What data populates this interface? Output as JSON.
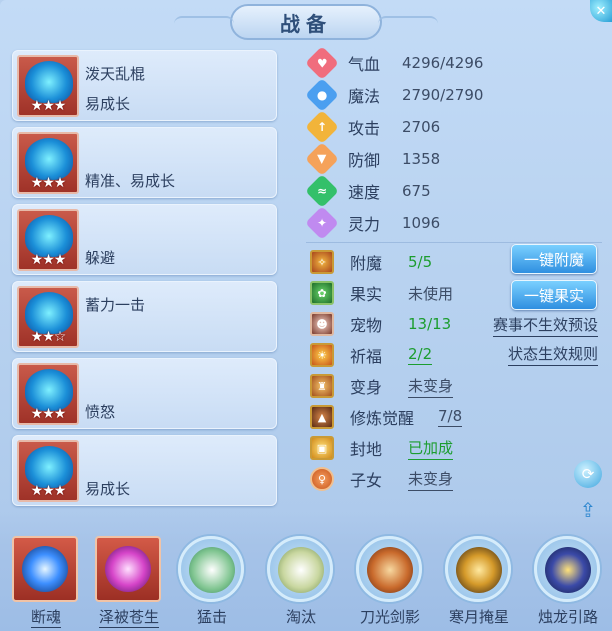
{
  "header": {
    "title": "战备"
  },
  "skills": [
    {
      "name1": "泼天乱棍",
      "name2": "易成长",
      "stars": "★★★",
      "color": "#1d97e0"
    },
    {
      "name1": "",
      "name2": "精准、易成长",
      "stars": "★★★",
      "color": "#1d97e0"
    },
    {
      "name1": "",
      "name2": "躲避",
      "stars": "★★★",
      "color": "#1d97e0"
    },
    {
      "name1": "蓄力一击",
      "name2": "",
      "stars": "★★☆",
      "color": "#1d97e0"
    },
    {
      "name1": "",
      "name2": "愤怒",
      "stars": "★★★",
      "color": "#1d97e0"
    },
    {
      "name1": "",
      "name2": "易成长",
      "stars": "★★★",
      "color": "#1d97e0"
    }
  ],
  "stats": [
    {
      "label": "气血",
      "value": "4296/4296",
      "icon": "heart-icon",
      "color": "#f06d7d",
      "glyph": "♥"
    },
    {
      "label": "魔法",
      "value": "2790/2790",
      "icon": "magic-icon",
      "color": "#4b9ff0",
      "glyph": "●"
    },
    {
      "label": "攻击",
      "value": "2706",
      "icon": "sword-icon",
      "color": "#f2b43a",
      "glyph": "↑"
    },
    {
      "label": "防御",
      "value": "1358",
      "icon": "shield-icon",
      "color": "#f5a25a",
      "glyph": "▼"
    },
    {
      "label": "速度",
      "value": "675",
      "icon": "speed-icon",
      "color": "#33c06a",
      "glyph": "≈"
    },
    {
      "label": "灵力",
      "value": "1096",
      "icon": "spirit-icon",
      "color": "#c08af0",
      "glyph": "✦"
    }
  ],
  "extras": [
    {
      "label": "附魔",
      "value": "5/5",
      "style": "green",
      "icon": "enchant-icon"
    },
    {
      "label": "果实",
      "value": "未使用",
      "style": "plain",
      "icon": "fruit-icon"
    },
    {
      "label": "宠物",
      "value": "13/13",
      "style": "green",
      "icon": "pet-icon"
    },
    {
      "label": "祈福",
      "value": "2/2",
      "style": "green-ul",
      "icon": "blessing-icon"
    },
    {
      "label": "变身",
      "value": "未变身",
      "style": "ul",
      "icon": "transform-icon"
    },
    {
      "label": "修炼觉醒",
      "value": "7/8",
      "style": "ul",
      "icon": "cultivation-icon"
    },
    {
      "label": "封地",
      "value": "已加成",
      "style": "green-ul",
      "icon": "fief-icon"
    },
    {
      "label": "子女",
      "value": "未变身",
      "style": "ul",
      "icon": "child-icon"
    }
  ],
  "buttons": {
    "enchant": "一键附魔",
    "fruit": "一键果实"
  },
  "links": {
    "preset": "赛事不生效预设",
    "rules": "状态生效规则"
  },
  "bottom_skills": [
    {
      "label": "断魂",
      "shape": "square",
      "underline": true,
      "color": "#3d8fff"
    },
    {
      "label": "泽被苍生",
      "shape": "square",
      "underline": true,
      "color": "#d645c9"
    },
    {
      "label": "猛击",
      "shape": "round",
      "underline": false,
      "color": "#7ec48f"
    },
    {
      "label": "淘汰",
      "shape": "round",
      "underline": false,
      "color": "#c9d7a0"
    },
    {
      "label": "刀光剑影",
      "shape": "round",
      "underline": false,
      "color": "#c96a2c"
    },
    {
      "label": "寒月掩星",
      "shape": "round",
      "underline": false,
      "color": "#d59a2a"
    },
    {
      "label": "烛龙引路",
      "shape": "round",
      "underline": false,
      "color": "#3b4aa8"
    }
  ]
}
